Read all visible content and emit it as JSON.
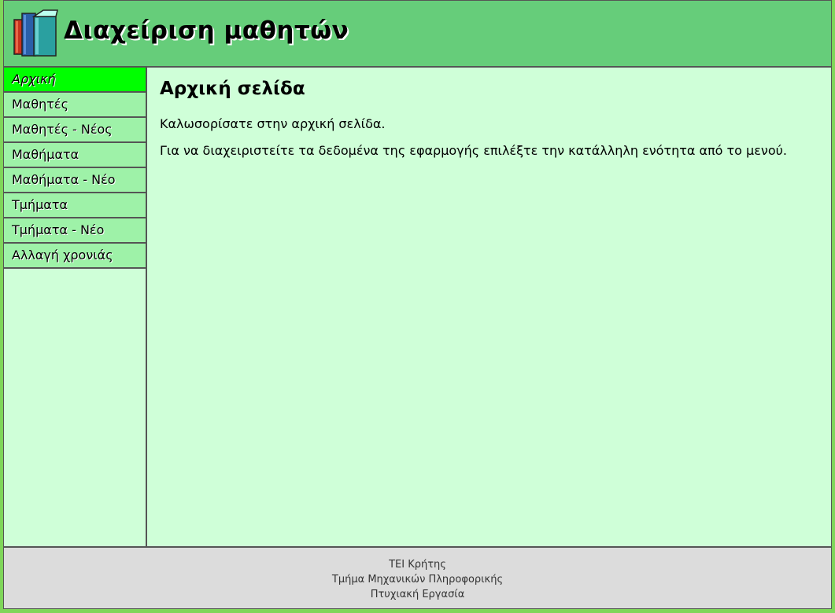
{
  "header": {
    "title": "Διαχείριση μαθητών",
    "logo_icon": "books-icon"
  },
  "sidebar": {
    "items": [
      {
        "label": "Αρχική",
        "active": true
      },
      {
        "label": "Μαθητές"
      },
      {
        "label": "Μαθητές - Νέος"
      },
      {
        "label": "Μαθήματα"
      },
      {
        "label": "Μαθήματα - Νέο"
      },
      {
        "label": "Τμήματα"
      },
      {
        "label": "Τμήματα - Νέο"
      },
      {
        "label": "Αλλαγή χρονιάς"
      }
    ]
  },
  "main": {
    "heading": "Αρχική σελίδα",
    "paragraphs": [
      "Καλωσορίσατε στην αρχική σελίδα.",
      "Για να διαχειριστείτε τα δεδομένα της εφαρμογής επιλέξτε την κατάλληλη ενότητα από το μενού."
    ]
  },
  "footer": {
    "lines": [
      "ΤΕΙ Κρήτης",
      "Τμήμα Μηχανικών Πληροφορικής",
      "Πτυχιακή Εργασία"
    ]
  },
  "colors": {
    "header_bg": "#66cd7a",
    "nav_bg": "#9ef2a8",
    "nav_active_bg": "#00ff00",
    "content_bg": "#cfffd8",
    "footer_bg": "#dcdcdc",
    "page_bg": "#7fd65a"
  }
}
